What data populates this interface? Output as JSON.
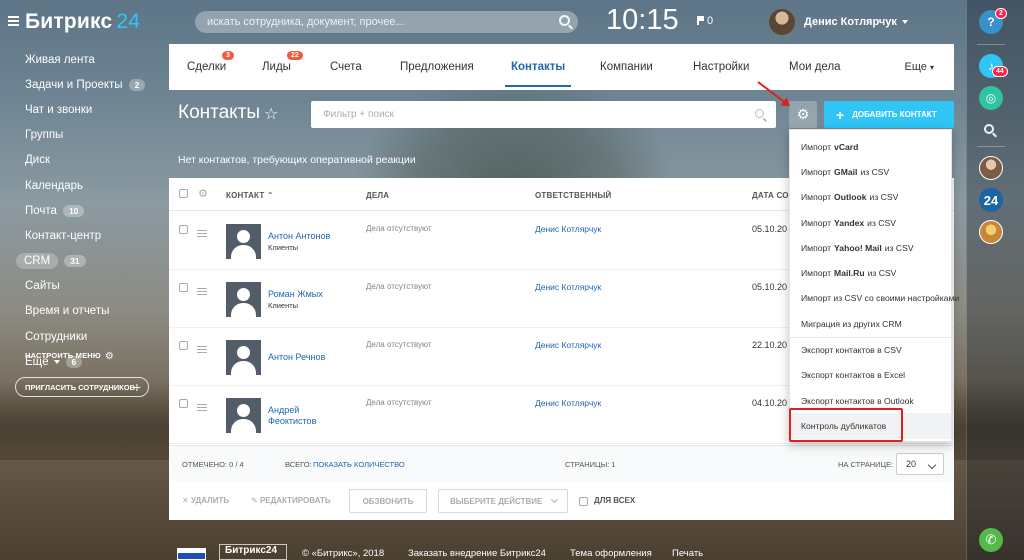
{
  "app": {
    "logo_text": "Битрикс",
    "logo_num": "24"
  },
  "header": {
    "search_placeholder": "искать сотрудника, документ, прочее...",
    "clock": "10:15",
    "flag_count": "0",
    "user_name": "Денис Котлярчук"
  },
  "sidebar": {
    "items": [
      {
        "label": "Живая лента",
        "count": ""
      },
      {
        "label": "Задачи и Проекты",
        "count": "2"
      },
      {
        "label": "Чат и звонки",
        "count": ""
      },
      {
        "label": "Группы",
        "count": ""
      },
      {
        "label": "Диск",
        "count": ""
      },
      {
        "label": "Календарь",
        "count": ""
      },
      {
        "label": "Почта",
        "count": "10"
      },
      {
        "label": "Контакт-центр",
        "count": ""
      },
      {
        "label": "CRM",
        "count": "31"
      },
      {
        "label": "Сайты",
        "count": ""
      },
      {
        "label": "Время и отчеты",
        "count": ""
      },
      {
        "label": "Сотрудники",
        "count": ""
      },
      {
        "label": "Ещё",
        "count": "6"
      }
    ],
    "settings_label": "НАСТРОИТЬ МЕНЮ",
    "invite_label": "ПРИГЛАСИТЬ СОТРУДНИКОВ"
  },
  "rail": {
    "help_badge": "2",
    "notify_badge": "44",
    "avatar_num": "24"
  },
  "tabs": {
    "items": [
      {
        "label": "Сделки",
        "badge": "3"
      },
      {
        "label": "Лиды",
        "badge": "22"
      },
      {
        "label": "Счета",
        "badge": ""
      },
      {
        "label": "Предложения",
        "badge": ""
      },
      {
        "label": "Контакты",
        "badge": ""
      },
      {
        "label": "Компании",
        "badge": ""
      },
      {
        "label": "Настройки",
        "badge": ""
      },
      {
        "label": "Мои дела",
        "badge": ""
      }
    ],
    "more_label": "Еще"
  },
  "page": {
    "title": "Контакты",
    "filter_placeholder": "Фильтр + поиск",
    "add_button": "ДОБАВИТЬ КОНТАКТ",
    "notice": "Нет контактов, требующих оперативной реакции"
  },
  "grid": {
    "headers": {
      "contact": "КОНТАКТ",
      "deals": "ДЕЛА",
      "responsible": "ОТВЕТСТВЕННЫЙ",
      "date": "ДАТА СОЗ"
    },
    "rows": [
      {
        "name": "Антон Антонов",
        "type": "Клиенты",
        "deals": "Дела отсутствуют",
        "responsible": "Денис Котлярчук",
        "date": "05.10.20"
      },
      {
        "name": "Роман Жмых",
        "type": "Клиенты",
        "deals": "Дела отсутствуют",
        "responsible": "Денис Котлярчук",
        "date": "05.10.20"
      },
      {
        "name": "Антон Речнов",
        "type": "",
        "deals": "Дела отсутствуют",
        "responsible": "Денис Котлярчук",
        "date": "22.10.20"
      },
      {
        "name": "Андрей Феоктистов",
        "type": "",
        "deals": "Дела отсутствуют",
        "responsible": "Денис Котлярчук",
        "date": "04.10.20"
      }
    ],
    "footer": {
      "selected": "ОТМЕЧЕНО: 0 / 4",
      "total_label": "ВСЕГО:",
      "total_link": "ПОКАЗАТЬ КОЛИЧЕСТВО",
      "pages": "СТРАНИЦЫ: 1",
      "perpage_label": "НА СТРАНИЦЕ:",
      "perpage_value": "20"
    },
    "actions": {
      "delete": "УДАЛИТЬ",
      "edit": "РЕДАКТИРОВАТЬ",
      "call": "ОБЗВОНИТЬ",
      "choose": "ВЫБЕРИТЕ ДЕЙСТВИЕ",
      "for_all": "ДЛЯ ВСЕХ"
    }
  },
  "dropdown": {
    "items": [
      {
        "pre": "Импорт",
        "bold": "vCard",
        "post": ""
      },
      {
        "pre": "Импорт",
        "bold": "GMail",
        "post": "из CSV"
      },
      {
        "pre": "Импорт",
        "bold": "Outlook",
        "post": "из CSV"
      },
      {
        "pre": "Импорт",
        "bold": "Yandex",
        "post": "из CSV"
      },
      {
        "pre": "Импорт",
        "bold": "Yahoo! Mail",
        "post": "из CSV"
      },
      {
        "pre": "Импорт",
        "bold": "Mail.Ru",
        "post": "из CSV"
      },
      {
        "pre": "Импорт из CSV со своими настройками",
        "bold": "",
        "post": ""
      },
      {
        "pre": "Миграция из других CRM",
        "bold": "",
        "post": ""
      },
      {
        "pre": "Экспорт контактов в CSV",
        "bold": "",
        "post": ""
      },
      {
        "pre": "Экспорт контактов в Excel",
        "bold": "",
        "post": ""
      },
      {
        "pre": "Экспорт контактов в Outlook",
        "bold": "",
        "post": ""
      },
      {
        "pre": "Контроль дубликатов",
        "bold": "",
        "post": ""
      }
    ]
  },
  "footer": {
    "brand": "Битрикс24",
    "copyright": "© «Битрикс», 2018",
    "order": "Заказать внедрение Битрикс24",
    "theme": "Тема оформления",
    "print": "Печать"
  },
  "colors": {
    "accent": "#2fc6f6",
    "link": "#2067b0",
    "badge": "#f55a3e",
    "annotation": "#e02020"
  }
}
